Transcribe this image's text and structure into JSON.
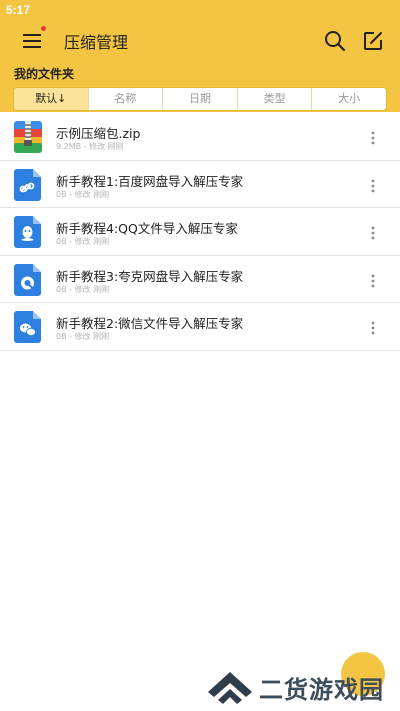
{
  "status_bar": {
    "time": "5:17"
  },
  "app_bar": {
    "title": "压缩管理"
  },
  "folder_label": "我的文件夹",
  "sort_tabs": [
    "默认↓",
    "名称",
    "日期",
    "类型",
    "大小"
  ],
  "files": [
    {
      "name": "示例压缩包.zip",
      "meta": "9.2MB - 修改 刚刚",
      "icon": "zip-archive-icon"
    },
    {
      "name": "新手教程1:百度网盘导入解压专家",
      "meta": "0B - 修改 刚刚",
      "icon": "baidu-netdisk-icon"
    },
    {
      "name": "新手教程4:QQ文件导入解压专家",
      "meta": "0B - 修改 刚刚",
      "icon": "qq-icon"
    },
    {
      "name": "新手教程3:夸克网盘导入解压专家",
      "meta": "0B - 修改 刚刚",
      "icon": "quark-netdisk-icon"
    },
    {
      "name": "新手教程2:微信文件导入解压专家",
      "meta": "0B - 修改 刚刚",
      "icon": "wechat-icon"
    }
  ],
  "watermark": {
    "text": "二货游戏园"
  },
  "colors": {
    "header": "#f4c542",
    "sort_active": "#fbe49a",
    "file_icon_blue": "#2d7fe0"
  }
}
